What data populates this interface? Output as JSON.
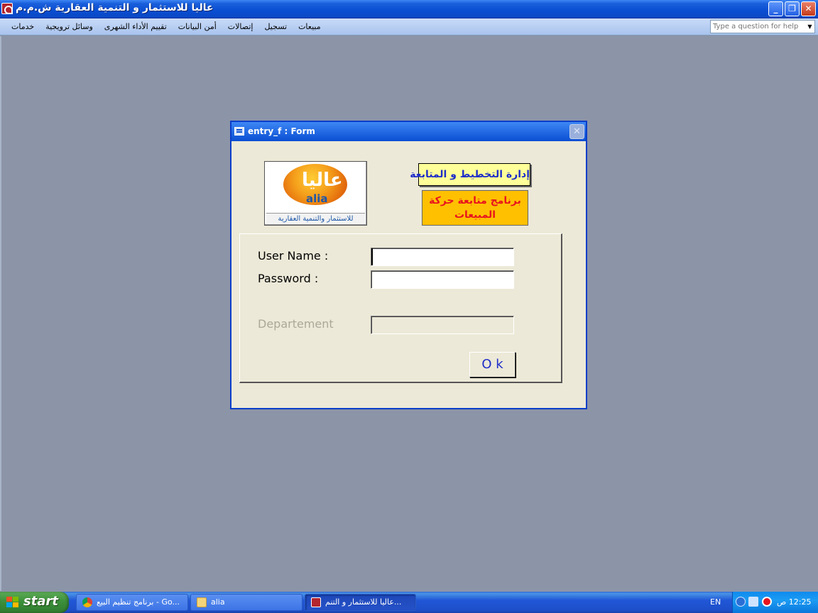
{
  "window": {
    "title": "عاليا للاستثمار و التنمية العقارية ش.م.م",
    "min_glyph": "_",
    "restore_glyph": "❐",
    "close_glyph": "✕"
  },
  "menu": {
    "items": [
      "مبيعات",
      "تسجيل",
      "إتصالات",
      "أمن البيانات",
      "تقييم الأداء الشهرى",
      "وسائل ترويجية",
      "خدمات"
    ],
    "help_placeholder": "Type a question for help",
    "help_arrow": "▼"
  },
  "dialog": {
    "caption": "entry_f : Form",
    "close_glyph": "✕",
    "logo": {
      "arabic": "عاليا",
      "english": "alia",
      "tagline": "للاستثمار والتنمية العقارية"
    },
    "dept_banner": "إدارة التخطيط و المتابعة",
    "program_banner": "برنامج متابعة حركة المبيعات",
    "user_label": "User Name :",
    "password_label": "Password :",
    "department_label": "Departement",
    "user_value": "",
    "password_value": "",
    "department_value": "",
    "ok_label": "O k"
  },
  "taskbar": {
    "start_label": "start",
    "tasks": [
      {
        "label": "برنامج تنظيم البيع - Go...",
        "icon": "chrome-icon"
      },
      {
        "label": "alia",
        "icon": "folder-icon"
      },
      {
        "label": "عاليا للاستثمار و التنم...",
        "icon": "access-icon"
      }
    ],
    "language": "EN",
    "clock": "12:25 ص"
  },
  "colors": {
    "workspace": "#8c94a8",
    "dialog_bg": "#ece9d8",
    "dept_banner_bg": "#ffff99",
    "program_banner_bg": "#ffc000",
    "program_banner_text": "#e8141e",
    "accent_text": "#1f2ec8"
  }
}
